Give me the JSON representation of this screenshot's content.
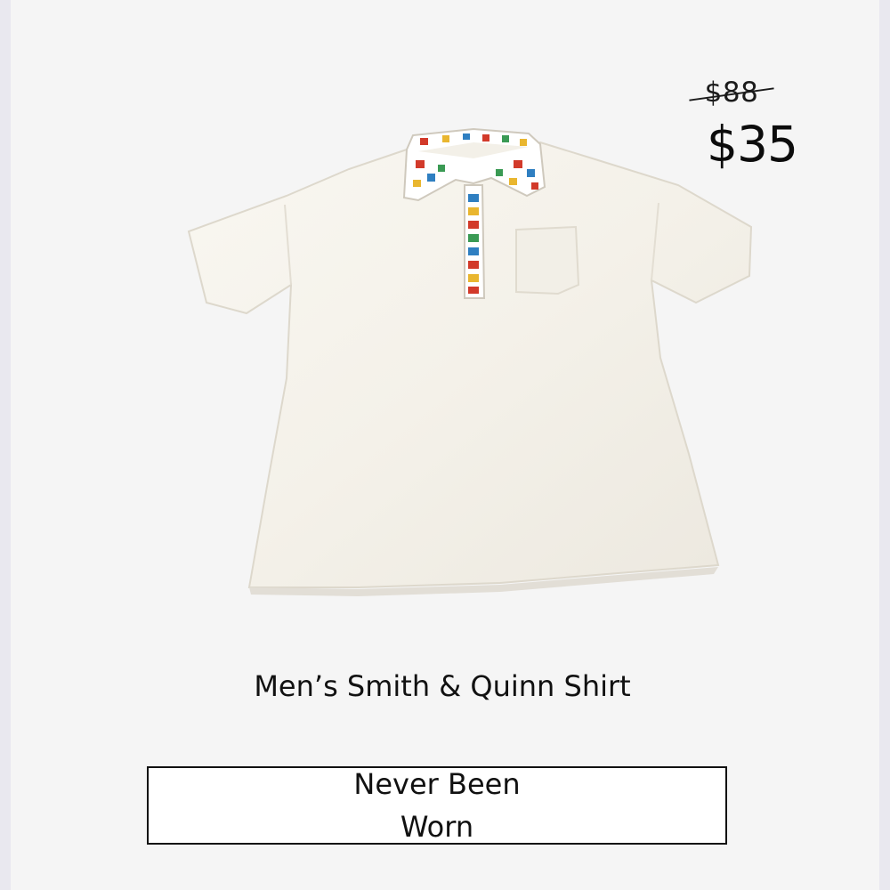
{
  "pricing": {
    "original_price": "$88",
    "sale_price": "$35"
  },
  "product": {
    "name": "Men’s Smith & Quinn Shirt",
    "image_subject": "white short-sleeve polo shirt with nautical signal-flag collar and placket"
  },
  "condition": {
    "label": "Never Been Worn"
  },
  "colors": {
    "card_background": "#f5f5f5",
    "page_background": "#e9e8ef",
    "text": "#111111",
    "shirt": "#f7f4ed"
  }
}
